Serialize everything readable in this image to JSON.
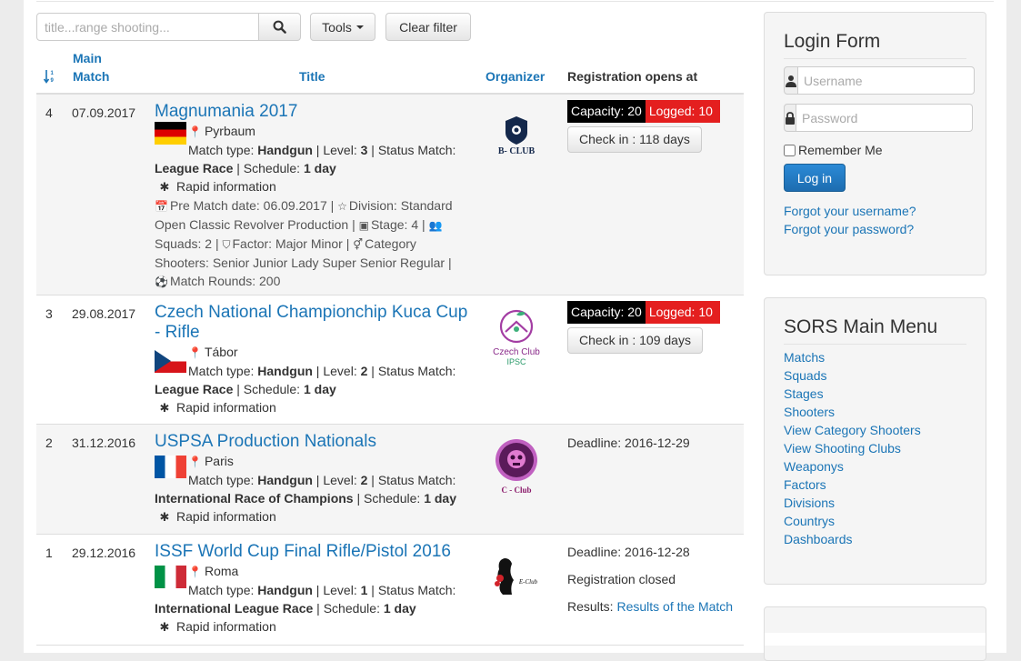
{
  "toolbar": {
    "search_placeholder": "title...range shooting...",
    "tools_label": "Tools",
    "clear_label": "Clear filter"
  },
  "table": {
    "headers": {
      "sort_icon": "sort-numeric-icon",
      "main_match_line1": "Main",
      "main_match_line2": "Match",
      "title": "Title",
      "organizer": "Organizer",
      "registration": "Registration opens at"
    },
    "rows": [
      {
        "num": "4",
        "date": "07.09.2017",
        "title": "Magnumania 2017",
        "flag": "germany-flag",
        "location": "Pyrbaum",
        "match_type_label": "Match type:",
        "match_type": "Handgun",
        "level_label": "Level:",
        "level": "3",
        "status_label": "Status Match:",
        "status": "League Race",
        "schedule_label": "Schedule:",
        "schedule": "1 day",
        "rapid": "Rapid information",
        "extra": {
          "pre_match": "Pre Match date: 06.09.2017 |",
          "division": "Division: Standard Open Classic Revolver Production |",
          "stage": "Stage: 4 |",
          "squads": "Squads: 2 |",
          "factor": "Factor: Major Minor |",
          "category": "Category Shooters: Senior Junior Lady Super Senior Regular |",
          "rounds": "Match Rounds: 200"
        },
        "organizer": "B- CLUB",
        "capacity": "Capacity: 20",
        "logged": "Logged: 10",
        "checkin": "Check in : 118 days"
      },
      {
        "num": "3",
        "date": "29.08.2017",
        "title": "Czech National Championchip Kuca Cup - Rifle",
        "flag": "czech-flag",
        "location": "Tábor",
        "match_type_label": "Match type:",
        "match_type": "Handgun",
        "level_label": "Level:",
        "level": "2",
        "status_label": "Status Match:",
        "status": "League Race",
        "schedule_label": "Schedule:",
        "schedule": "1 day",
        "rapid": "Rapid information",
        "organizer_line1": "Czech Club",
        "organizer_line2": "IPSC",
        "capacity": "Capacity: 20",
        "logged": "Logged: 10",
        "checkin": "Check in : 109 days"
      },
      {
        "num": "2",
        "date": "31.12.2016",
        "title": "USPSA Production Nationals",
        "flag": "france-flag",
        "location": "Paris",
        "match_type_label": "Match type:",
        "match_type": "Handgun",
        "level_label": "Level:",
        "level": "2",
        "status_label": "Status Match:",
        "status": "International Race of Champions",
        "schedule_label": "Schedule:",
        "schedule": "1 day",
        "rapid": "Rapid information",
        "organizer": "C - Club",
        "deadline": "Deadline: 2016-12-29"
      },
      {
        "num": "1",
        "date": "29.12.2016",
        "title": "ISSF World Cup Final Rifle/Pistol 2016",
        "flag": "italy-flag",
        "location": "Roma",
        "match_type_label": "Match type:",
        "match_type": "Handgun",
        "level_label": "Level:",
        "level": "1",
        "status_label": "Status Match:",
        "status": "International League Race",
        "schedule_label": "Schedule:",
        "schedule": "1 day",
        "rapid": "Rapid information",
        "organizer": "E-Club",
        "deadline": "Deadline: 2016-12-28",
        "reg_closed": "Registration closed",
        "results_label": "Results:",
        "results_link": "Results of the Match"
      }
    ]
  },
  "login": {
    "title": "Login Form",
    "username_placeholder": "Username",
    "password_placeholder": "Password",
    "remember": "Remember Me",
    "login_button": "Log in",
    "forgot_username": "Forgot your username?",
    "forgot_password": "Forgot your password?"
  },
  "menu": {
    "title": "SORS Main Menu",
    "items": [
      "Matchs",
      "Squads",
      "Stages",
      "Shooters",
      "View Category Shooters",
      "View Shooting Clubs",
      "Weaponys",
      "Factors",
      "Divisions",
      "Countrys",
      "Dashboards"
    ]
  },
  "colors": {
    "link": "#1b75b6",
    "capacity_bg": "#000000",
    "logged_bg": "#e41f1f",
    "login_button": "#2b8ad6"
  }
}
